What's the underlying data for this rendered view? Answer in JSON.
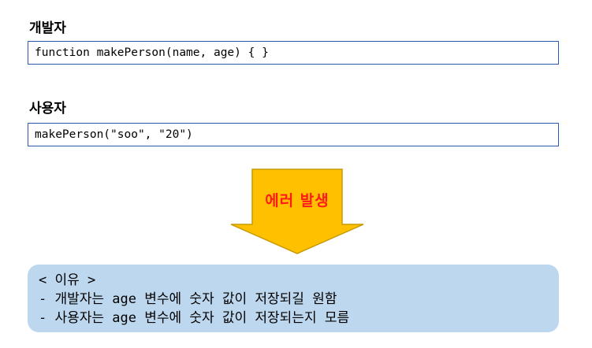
{
  "developer": {
    "label": "개발자",
    "code": "function makePerson(name, age) { }"
  },
  "user": {
    "label": "사용자",
    "code": "makePerson(\"soo\", \"20\")"
  },
  "arrow": {
    "label": "에러 발생",
    "fill_color": "#ffc000",
    "border_color": "#c59a00",
    "text_color": "#ff1a1a"
  },
  "reason": {
    "title": "< 이유 >",
    "lines": [
      "- 개발자는 age 변수에 숫자 값이 저장되길 원함",
      "- 사용자는 age 변수에 숫자 값이 저장되는지 모름"
    ],
    "background_color": "#bdd7ee"
  }
}
